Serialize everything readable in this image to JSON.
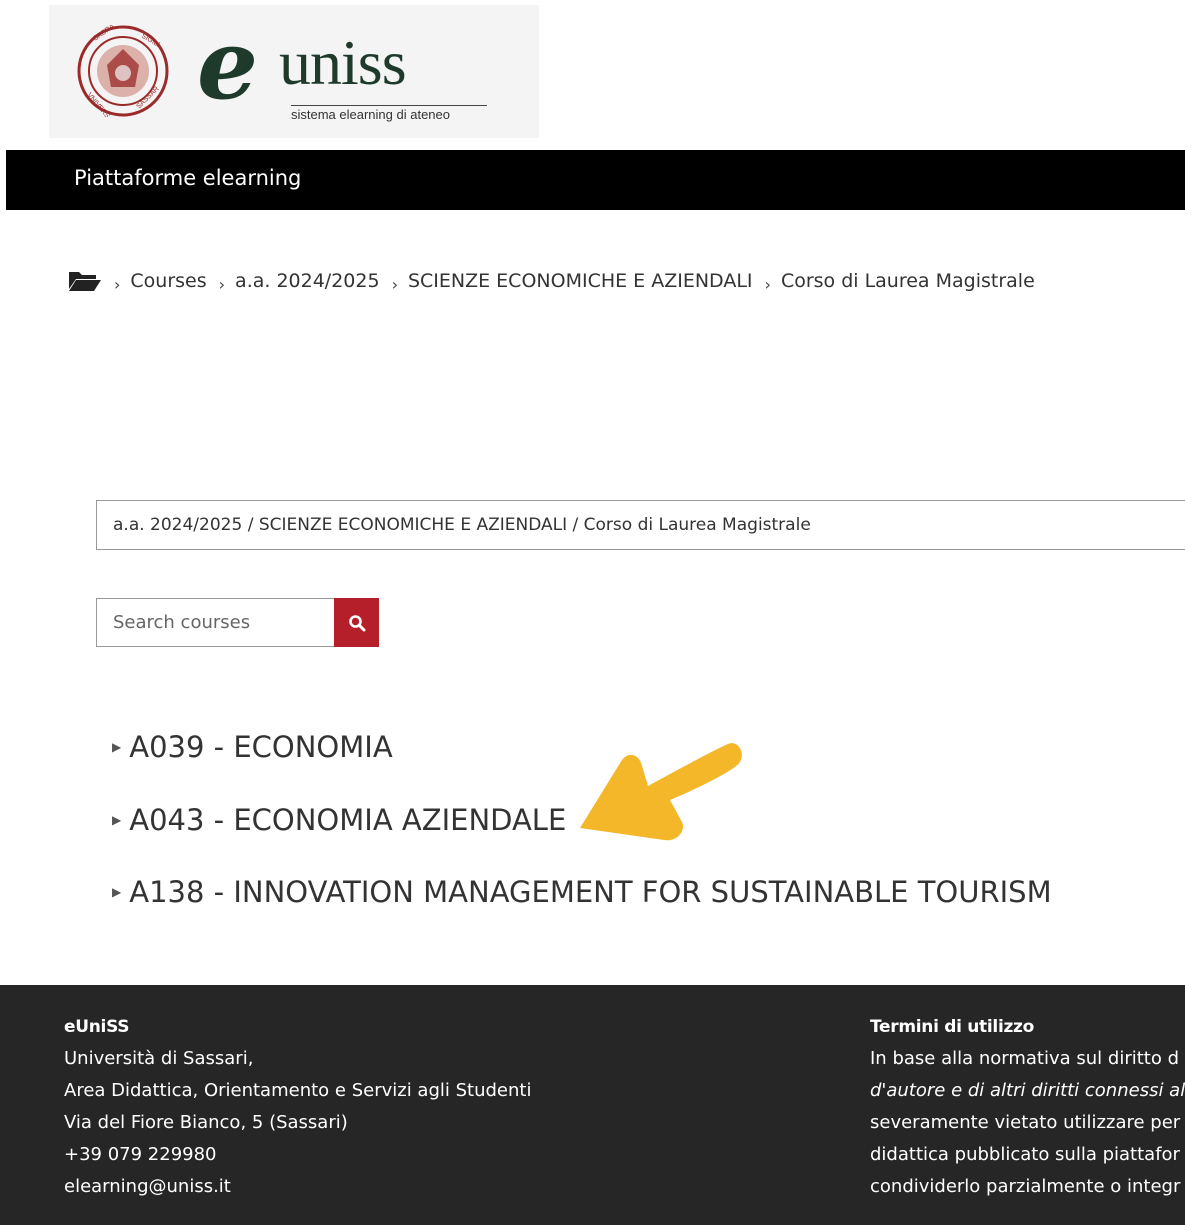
{
  "brand": {
    "name": "uniss",
    "tagline": "sistema elearning di ateneo"
  },
  "navbar": {
    "title": "Piattaforme elearning"
  },
  "breadcrumb": {
    "items": [
      "Courses",
      "a.a. 2024/2025",
      "SCIENZE ECONOMICHE E AZIENDALI",
      "Corso di Laurea Magistrale"
    ]
  },
  "category_select": {
    "value": "a.a. 2024/2025 / SCIENZE ECONOMICHE E AZIENDALI / Corso di Laurea Magistrale"
  },
  "search": {
    "placeholder": "Search courses"
  },
  "courses": [
    "A039 - ECONOMIA",
    "A043 - ECONOMIA AZIENDALE",
    "A138 - INNOVATION MANAGEMENT FOR SUSTAINABLE TOURISM"
  ],
  "colors": {
    "accent": "#b51f2a",
    "arrow": "#f5b72a",
    "navbar": "#000000",
    "footer": "#262626"
  },
  "footer": {
    "left": {
      "heading": "eUniSS",
      "lines": [
        "Università di Sassari,",
        "Area Didattica, Orientamento e Servizi agli Studenti",
        "Via del Fiore Bianco, 5 (Sassari)",
        "+39 079 229980",
        "elearning@uniss.it"
      ]
    },
    "right": {
      "heading": "Termini di utilizzo",
      "lines": [
        "In base alla normativa sul diritto d",
        "d'autore e di altri diritti connessi al s",
        "severamente vietato utilizzare per",
        "didattica pubblicato sulla piattafor",
        "condividerlo parzialmente o integr"
      ]
    }
  }
}
